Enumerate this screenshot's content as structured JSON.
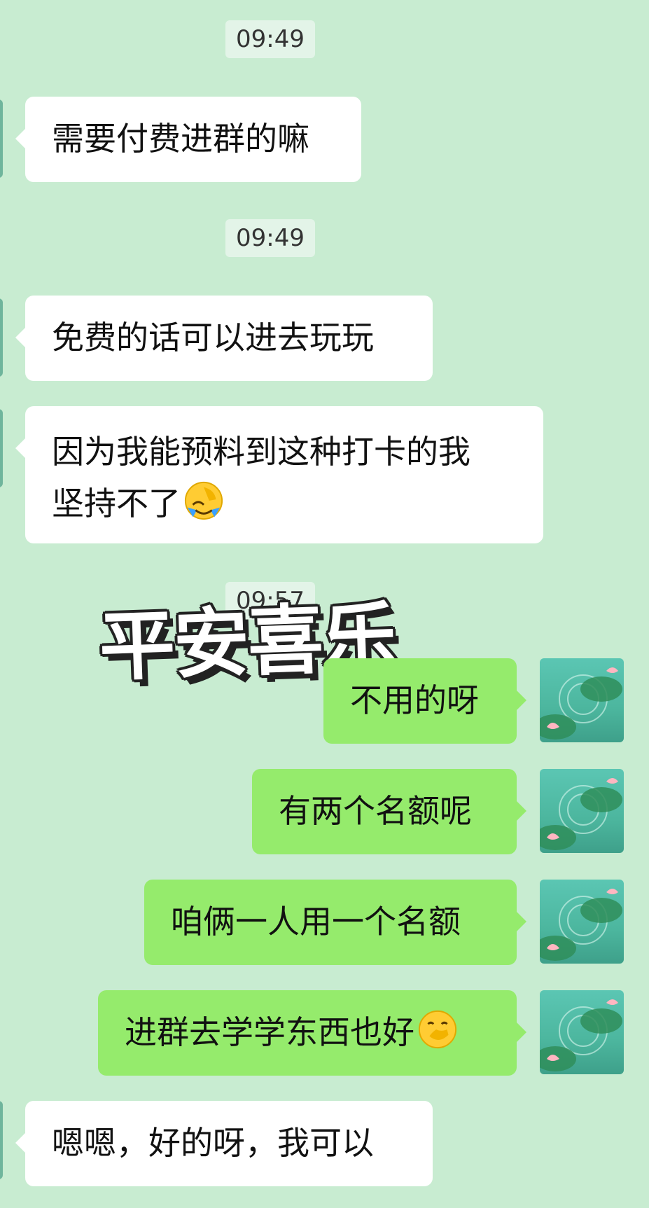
{
  "chat": {
    "timestamps": [
      "09:49",
      "09:49",
      "09:57"
    ],
    "messages_left": [
      {
        "text": "需要付费进群的嘛"
      },
      {
        "text": "免费的话可以进去玩玩"
      },
      {
        "line1": "因为我能预料到这种打卡的我",
        "line2": "坚持不了",
        "emoji": "face-with-hand-over-face-crying-emoji"
      },
      {
        "text": "嗯嗯，好的呀，我可以"
      }
    ],
    "sticker_text": "平安喜乐",
    "messages_right": [
      {
        "text": "不用的呀"
      },
      {
        "text": "有两个名额呢"
      },
      {
        "text": "咱俩一人用一个名额"
      },
      {
        "text": "进群去学学东西也好",
        "emoji": "face-with-hand-over-mouth-emoji"
      }
    ],
    "avatar_icon": "lotus-pond-avatar",
    "colors": {
      "background": "#c8ecd1",
      "left_bubble": "#ffffff",
      "right_bubble": "#95eb6c"
    }
  }
}
